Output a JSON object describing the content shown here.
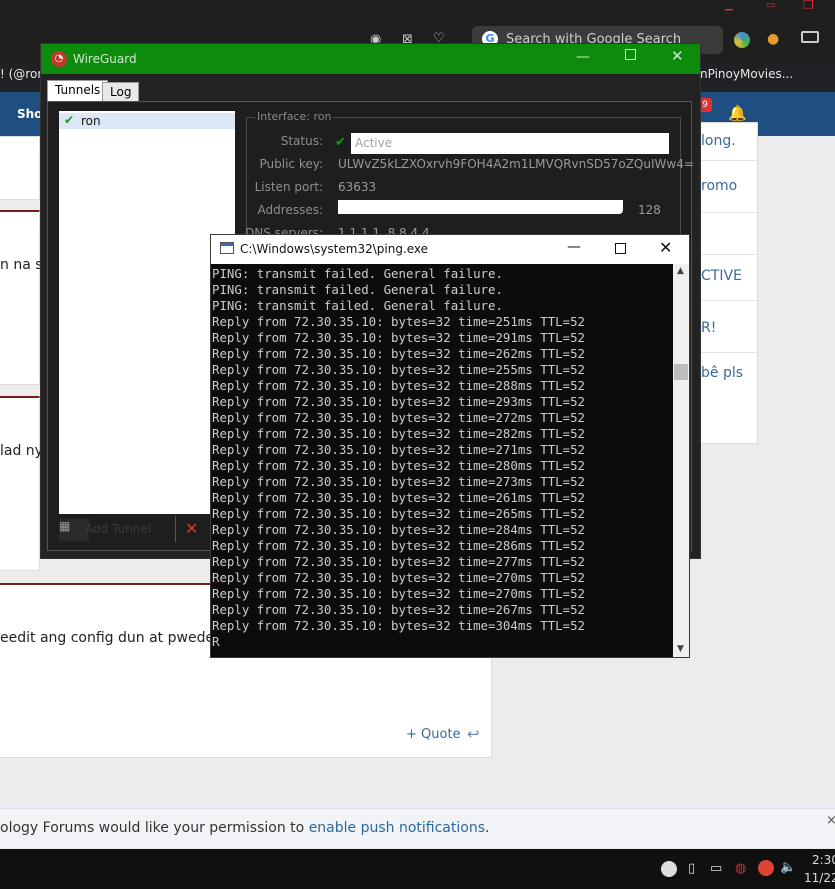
{
  "browser": {
    "search_placeholder": "Search with Google Search",
    "bookmark_left": "! (@ron",
    "bookmark_right": "nPinoyMovies..."
  },
  "forum": {
    "nav_label": "Sho",
    "notif_count": "9",
    "post_fragments": [
      "n na s",
      "lad ny",
      "eedit ang config dun at pwede 2"
    ],
    "quote_label": "+ Quote",
    "sidebar": [
      "long.",
      "romo",
      "CTIVE",
      "R!",
      "bê pls"
    ],
    "permission_text": "ology Forums would like your permission to ",
    "permission_link": "enable push notifications",
    "permission_end": "."
  },
  "taskbar": {
    "time": "2:30",
    "date": "11/22"
  },
  "wireguard": {
    "title": "WireGuard",
    "tabs": [
      "Tunnels",
      "Log"
    ],
    "tunnel_name": "ron",
    "interface_legend": "Interface: ron",
    "labels": {
      "status": "Status:",
      "public_key": "Public key:",
      "listen_port": "Listen port:",
      "addresses": "Addresses:",
      "dns": "DNS servers:"
    },
    "values": {
      "status": "Active",
      "public_key": "ULWvZ5kLZXOxrvh9FOH4A2m1LMVQRvnSD57oZQuIWw4=",
      "listen_port": "63633",
      "addresses_suffix": "128",
      "dns": "1.1.1.1, 8.8.4.4"
    },
    "add_tunnel": "Add Tunnel"
  },
  "cmd": {
    "title": "C:\\Windows\\system32\\ping.exe",
    "lines": [
      "PING: transmit failed. General failure.",
      "PING: transmit failed. General failure.",
      "PING: transmit failed. General failure.",
      "Reply from 72.30.35.10: bytes=32 time=251ms TTL=52",
      "Reply from 72.30.35.10: bytes=32 time=291ms TTL=52",
      "Reply from 72.30.35.10: bytes=32 time=262ms TTL=52",
      "Reply from 72.30.35.10: bytes=32 time=255ms TTL=52",
      "Reply from 72.30.35.10: bytes=32 time=288ms TTL=52",
      "Reply from 72.30.35.10: bytes=32 time=293ms TTL=52",
      "Reply from 72.30.35.10: bytes=32 time=272ms TTL=52",
      "Reply from 72.30.35.10: bytes=32 time=282ms TTL=52",
      "Reply from 72.30.35.10: bytes=32 time=271ms TTL=52",
      "Reply from 72.30.35.10: bytes=32 time=280ms TTL=52",
      "Reply from 72.30.35.10: bytes=32 time=273ms TTL=52",
      "Reply from 72.30.35.10: bytes=32 time=261ms TTL=52",
      "Reply from 72.30.35.10: bytes=32 time=265ms TTL=52",
      "Reply from 72.30.35.10: bytes=32 time=284ms TTL=52",
      "Reply from 72.30.35.10: bytes=32 time=286ms TTL=52",
      "Reply from 72.30.35.10: bytes=32 time=277ms TTL=52",
      "Reply from 72.30.35.10: bytes=32 time=270ms TTL=52",
      "Reply from 72.30.35.10: bytes=32 time=270ms TTL=52",
      "Reply from 72.30.35.10: bytes=32 time=267ms TTL=52",
      "Reply from 72.30.35.10: bytes=32 time=304ms TTL=52",
      "R"
    ]
  },
  "colors": {
    "wireguard_titlebar": "#0d8b0d",
    "forum_nav": "#1f4e80",
    "link": "#2a6a9e"
  }
}
